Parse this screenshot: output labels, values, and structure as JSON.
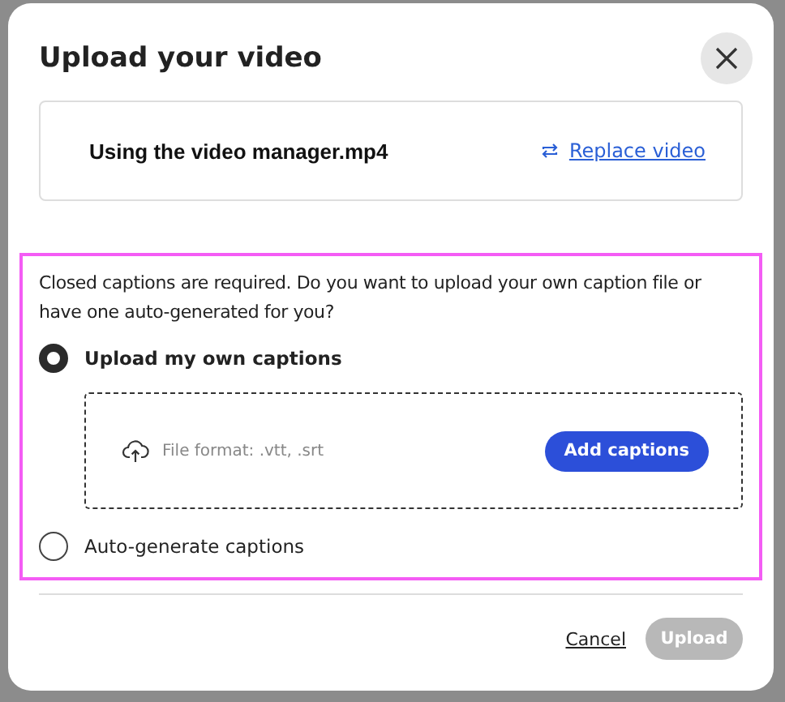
{
  "dialog": {
    "title": "Upload your video"
  },
  "video": {
    "file_name": "Using the video manager.mp4",
    "replace_link": "Replace video"
  },
  "captions": {
    "prompt": "Closed captions are required. Do you want to upload your own caption file or have one auto-generated for you?",
    "options": [
      {
        "label": "Upload my own captions",
        "selected": true
      },
      {
        "label": "Auto-generate captions",
        "selected": false
      }
    ],
    "dropzone": {
      "hint": "File format: .vtt, .srt",
      "button": "Add captions"
    }
  },
  "footer": {
    "cancel": "Cancel",
    "upload": {
      "label": "Upload",
      "disabled": true
    }
  }
}
